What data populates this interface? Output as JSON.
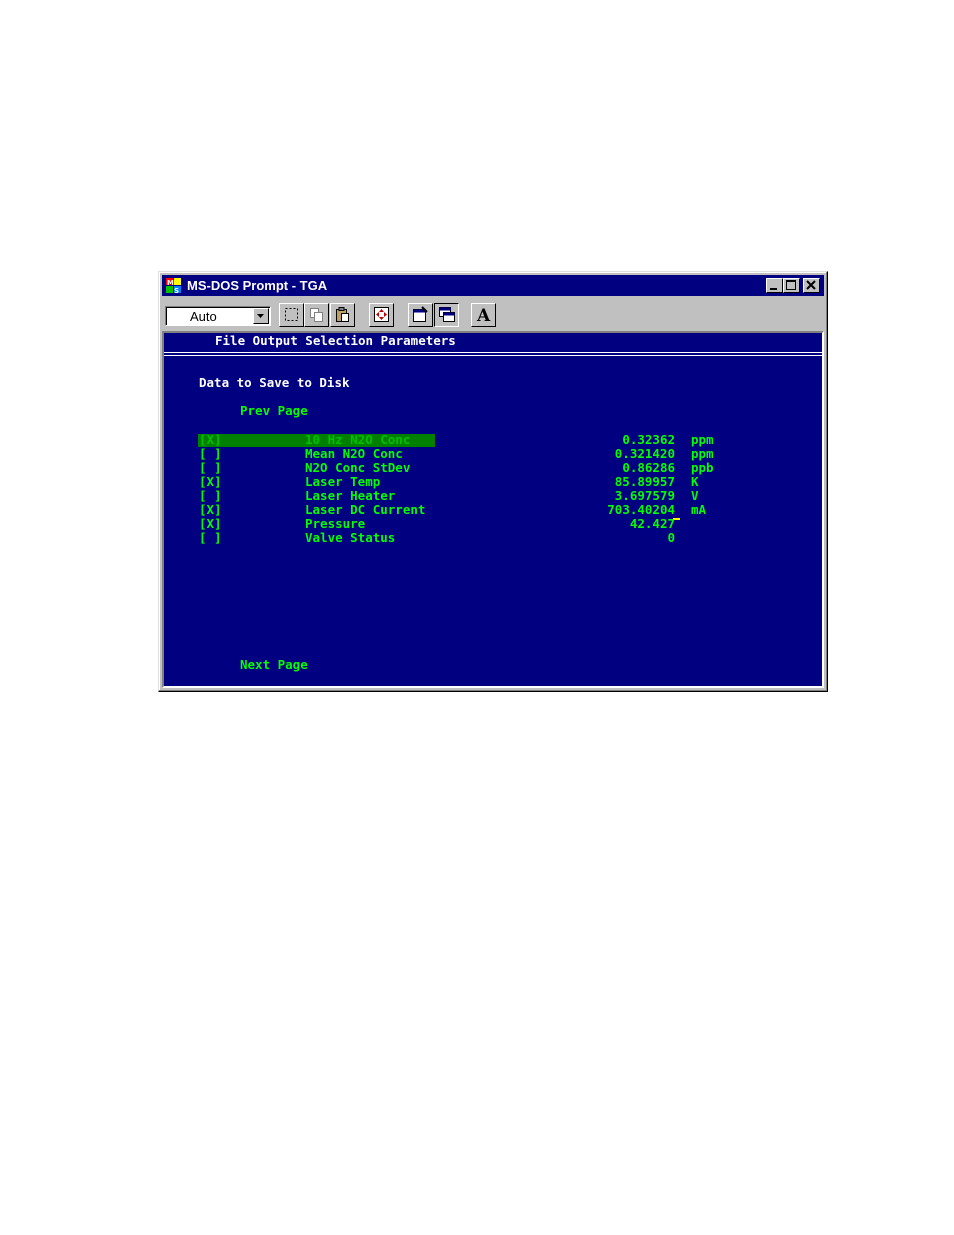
{
  "window": {
    "title": "MS-DOS Prompt - TGA"
  },
  "toolbar": {
    "font_combo_value": "Auto",
    "tools": [
      "mark-icon",
      "copy-icon",
      "paste-icon",
      "fullscreen-icon",
      "properties-icon",
      "background-icon",
      "font-icon"
    ],
    "font_tool_glyph": "A"
  },
  "screen": {
    "header": "File Output Selection Parameters",
    "section_title": "Data to Save to Disk",
    "prev_page": "Prev Page",
    "next_page": "Next Page",
    "rows": [
      {
        "check": "[X]",
        "label": "10 Hz N2O Conc",
        "value": "0.32362",
        "unit": "ppm",
        "selected": true
      },
      {
        "check": "[ ]",
        "label": "Mean N2O Conc",
        "value": "0.321420",
        "unit": "ppm",
        "selected": false
      },
      {
        "check": "[ ]",
        "label": "N2O Conc StDev",
        "value": "0.86286",
        "unit": "ppb",
        "selected": false
      },
      {
        "check": "[X]",
        "label": "Laser Temp",
        "value": "85.89957",
        "unit": "K",
        "selected": false
      },
      {
        "check": "[ ]",
        "label": "Laser Heater",
        "value": "3.697579",
        "unit": "V",
        "selected": false
      },
      {
        "check": "[X]",
        "label": "Laser DC Current",
        "value": "703.40204",
        "unit": "mA",
        "selected": false
      },
      {
        "check": "[X]",
        "label": "Pressure",
        "value": "42.427",
        "unit": "",
        "selected": false
      },
      {
        "check": "[ ]",
        "label": "Valve Status",
        "value": "0",
        "unit": "",
        "selected": false
      }
    ]
  },
  "colors": {
    "screen_bg": "#000080",
    "text_white": "#ffffff",
    "text_green": "#00ff00",
    "highlight": "#008000",
    "cursor": "#ffff00"
  }
}
